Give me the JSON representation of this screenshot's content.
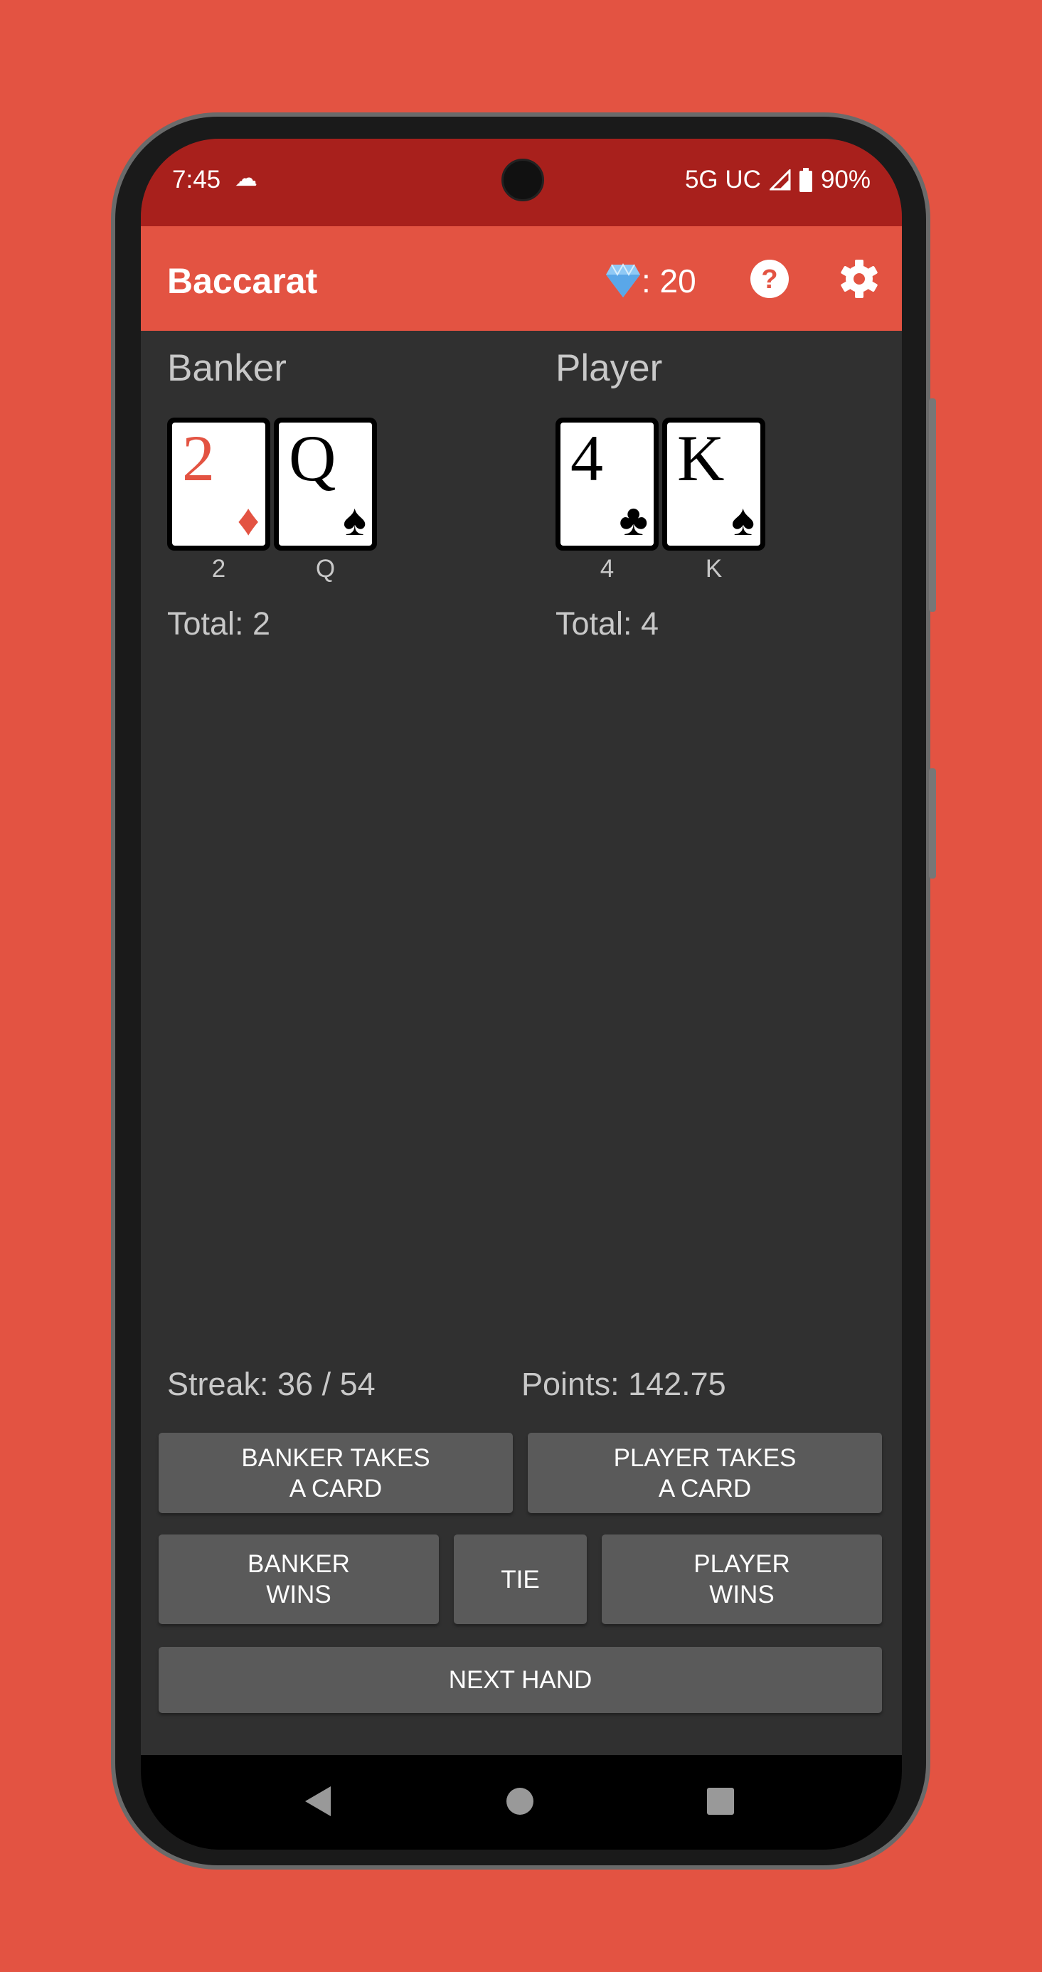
{
  "status_bar": {
    "time": "7:45",
    "network": "5G UC",
    "battery": "90%",
    "icons": [
      "cloud-icon",
      "signal-icon",
      "battery-icon"
    ]
  },
  "app_bar": {
    "title": "Baccarat",
    "gems": ": 20",
    "gem_icon": "diamond-icon",
    "help_icon": "help-icon",
    "settings_icon": "gear-icon"
  },
  "banker": {
    "title": "Banker",
    "cards": [
      {
        "rank": "2",
        "suit": "♦",
        "label": "2",
        "color": "#e35342"
      },
      {
        "rank": "Q",
        "suit": "♠",
        "label": "Q",
        "color": "#000000"
      }
    ],
    "total": "Total: 2"
  },
  "player": {
    "title": "Player",
    "cards": [
      {
        "rank": "4",
        "suit": "♣",
        "label": "4",
        "color": "#000000"
      },
      {
        "rank": "K",
        "suit": "♠",
        "label": "K",
        "color": "#000000"
      }
    ],
    "total": "Total: 4"
  },
  "stats": {
    "streak": "Streak: 36 / 54",
    "points": "Points: 142.75"
  },
  "buttons": {
    "banker_takes": "BANKER TAKES\nA CARD",
    "player_takes": "PLAYER TAKES\nA CARD",
    "banker_wins": "BANKER\nWINS",
    "tie": "TIE",
    "player_wins": "PLAYER\nWINS",
    "next_hand": "NEXT HAND"
  },
  "colors": {
    "background": "#e35342",
    "status_bar": "#a8201c",
    "content": "#303030",
    "button": "#5a5a5a"
  }
}
